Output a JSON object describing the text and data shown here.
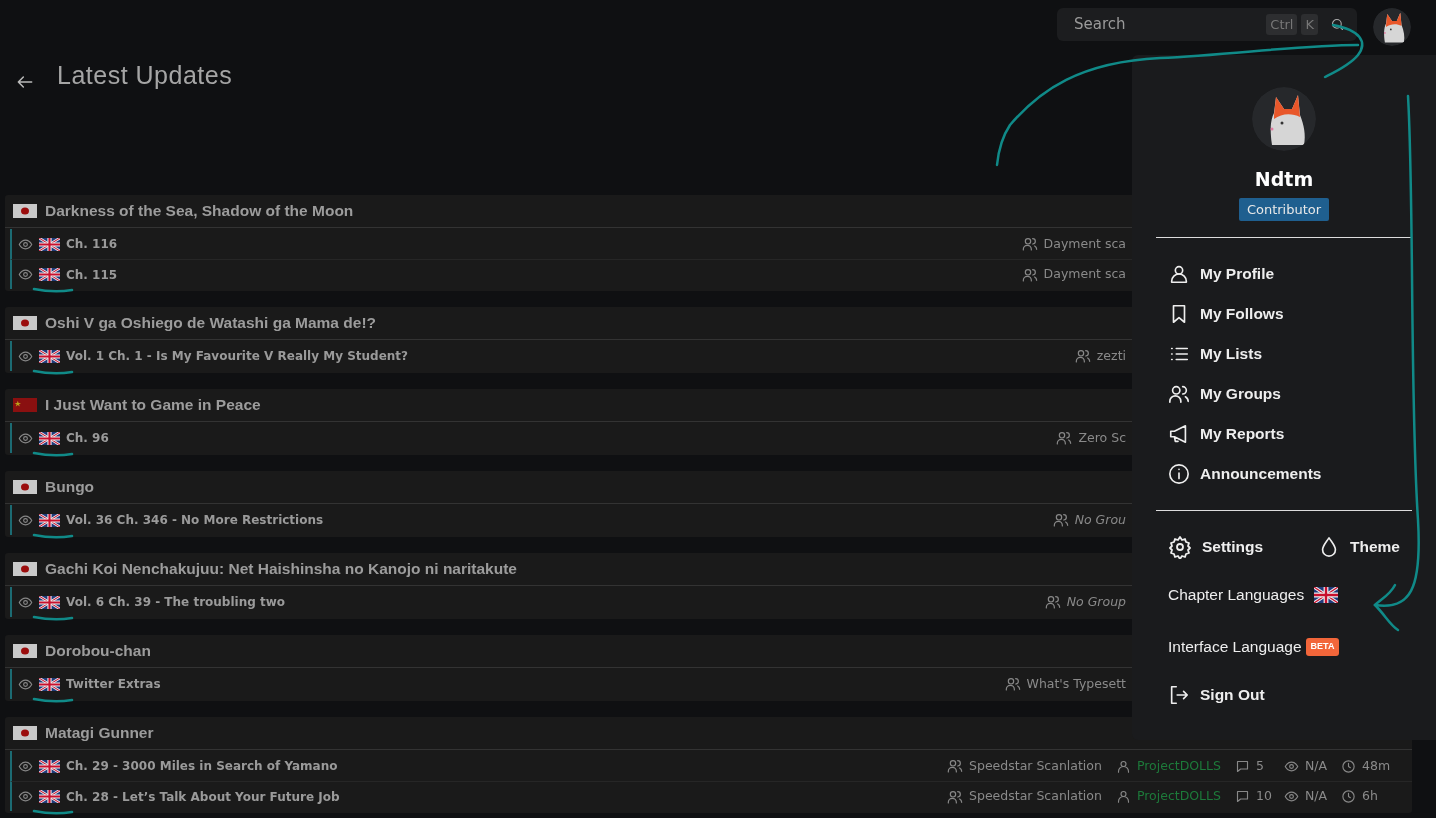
{
  "header": {
    "title": "Latest Updates"
  },
  "search": {
    "placeholder": "Search",
    "shortcut": [
      "Ctrl",
      "K"
    ]
  },
  "series": [
    {
      "title": "Darkness of the Sea, Shadow of the Moon",
      "kind": "japanese",
      "chapters": [
        {
          "title": "Ch. 116",
          "group": "Dayment sca",
          "no_group": false,
          "underlined": false
        },
        {
          "title": "Ch. 115",
          "group": "Dayment sca",
          "no_group": false,
          "underlined": true
        }
      ]
    },
    {
      "title": "Oshi V ga Oshiego de Watashi ga Mama de!?",
      "kind": "japanese",
      "chapters": [
        {
          "title": "Vol. 1 Ch. 1 - Is My Favourite V Really My Student?",
          "group": "zezti",
          "no_group": false,
          "underlined": true
        }
      ]
    },
    {
      "title": "I Just Want to Game in Peace",
      "kind": "chinese",
      "chapters": [
        {
          "title": "Ch. 96",
          "group": "Zero Sc",
          "no_group": false,
          "underlined": true
        }
      ]
    },
    {
      "title": "Bungo",
      "kind": "japanese",
      "chapters": [
        {
          "title": "Vol. 36 Ch. 346 - No More Restrictions",
          "group": "No Grou",
          "no_group": true,
          "underlined": true
        }
      ]
    },
    {
      "title": "Gachi Koi Nenchakujuu: Net Haishinsha no Kanojo ni naritakute",
      "kind": "japanese",
      "chapters": [
        {
          "title": "Vol. 6 Ch. 39 - The troubling two",
          "group": "No Group",
          "no_group": true,
          "underlined": true
        }
      ]
    },
    {
      "title": "Dorobou-chan",
      "kind": "japanese",
      "chapters": [
        {
          "title": "Twitter Extras",
          "group": "What's Typesett",
          "no_group": false,
          "underlined": true
        }
      ]
    },
    {
      "title": "Matagi Gunner",
      "kind": "japanese",
      "chapters": [
        {
          "title": "Ch. 29 - 3000 Miles in Search of Yamano",
          "group": "Speedstar Scanlation",
          "no_group": false,
          "underlined": false,
          "uploader": "ProjectDOLLS",
          "comments": "5",
          "views": "N/A",
          "time": "48m"
        },
        {
          "title": "Ch. 28 - Let’s Talk About Your Future Job",
          "group": "Speedstar Scanlation",
          "no_group": false,
          "underlined": true,
          "uploader": "ProjectDOLLS",
          "comments": "10",
          "views": "N/A",
          "time": "6h"
        }
      ]
    }
  ],
  "user_menu": {
    "username": "Ndtm",
    "role": "Contributor",
    "items": [
      {
        "label": "My Profile"
      },
      {
        "label": "My Follows"
      },
      {
        "label": "My Lists"
      },
      {
        "label": "My Groups"
      },
      {
        "label": "My Reports"
      },
      {
        "label": "Announcements"
      }
    ],
    "settings": "Settings",
    "theme": "Theme",
    "chapter_languages": {
      "label": "Chapter Languages"
    },
    "interface_language": {
      "label": "Interface Language",
      "badge": "BETA"
    },
    "sign_out": "Sign Out"
  }
}
